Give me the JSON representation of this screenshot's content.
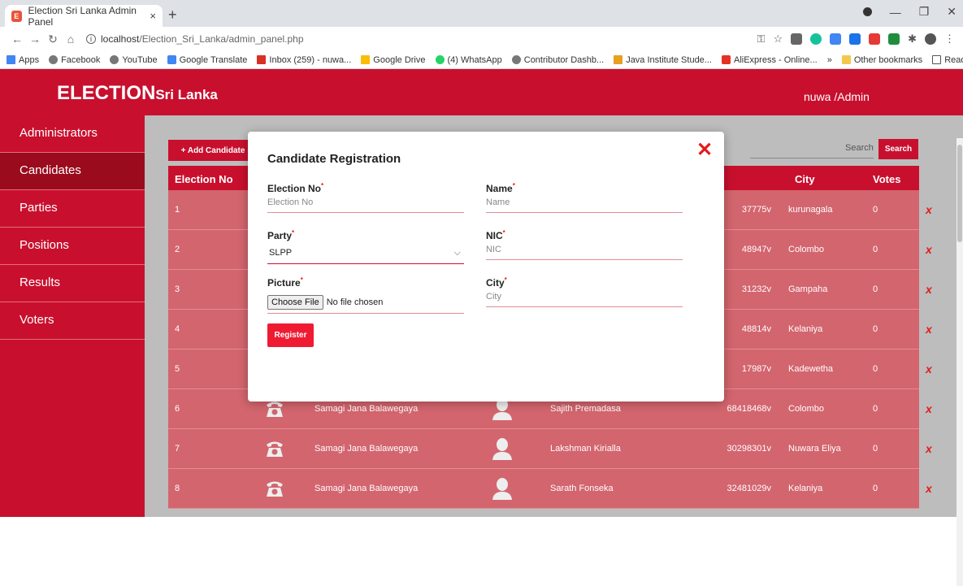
{
  "browser": {
    "tab_title": "Election Sri Lanka Admin Panel",
    "tab_close": "×",
    "new_tab": "+",
    "url_host": "localhost",
    "url_path": "/Election_Sri_Lanka/admin_panel.php",
    "bookmarks": [
      "Apps",
      "Facebook",
      "YouTube",
      "Google Translate",
      "Inbox (259) - nuwa...",
      "Google Drive",
      "(4) WhatsApp",
      "Contributor Dashb...",
      "Java Institute Stude...",
      "AliExpress - Online..."
    ],
    "bookmarks_more": "»",
    "other_bookmarks": "Other bookmarks",
    "reading_list": "Reading list"
  },
  "header": {
    "logo_bold": "ELECTION",
    "logo_rest": "Sri Lanka",
    "user": "nuwa /Admin"
  },
  "sidebar": {
    "items": [
      "Administrators",
      "Candidates",
      "Parties",
      "Positions",
      "Results",
      "Voters"
    ],
    "active": "Candidates"
  },
  "toolbar": {
    "add_label": "+ Add Candidate",
    "search_placeholder": "Search",
    "search_label": "Search"
  },
  "table": {
    "headers": {
      "election_no": "Election No",
      "city": "City",
      "votes": "Votes"
    },
    "rows": [
      {
        "no": "1",
        "party": "",
        "name": "",
        "nic": "37775v",
        "city": "kurunagala",
        "votes": "0"
      },
      {
        "no": "2",
        "party": "",
        "name": "",
        "nic": "48947v",
        "city": "Colombo",
        "votes": "0"
      },
      {
        "no": "3",
        "party": "",
        "name": "",
        "nic": "31232v",
        "city": "Gampaha",
        "votes": "0"
      },
      {
        "no": "4",
        "party": "",
        "name": "",
        "nic": "48814v",
        "city": "Kelaniya",
        "votes": "0"
      },
      {
        "no": "5",
        "party": "",
        "name": "",
        "nic": "17987v",
        "city": "Kadewetha",
        "votes": "0"
      },
      {
        "no": "6",
        "party": "Samagi Jana Balawegaya",
        "name": "Sajith Premadasa",
        "nic": "68418468v",
        "city": "Colombo",
        "votes": "0"
      },
      {
        "no": "7",
        "party": "Samagi Jana Balawegaya",
        "name": "Lakshman Kirialla",
        "nic": "30298301v",
        "city": "Nuwara Eliya",
        "votes": "0"
      },
      {
        "no": "8",
        "party": "Samagi Jana Balawegaya",
        "name": "Sarath Fonseka",
        "nic": "32481029v",
        "city": "Kelaniya",
        "votes": "0"
      }
    ],
    "delete_mark": "x"
  },
  "modal": {
    "title": "Candidate Registration",
    "close": "✕",
    "election_no_label": "Election No",
    "election_no_placeholder": "Election No",
    "name_label": "Name",
    "name_placeholder": "Name",
    "party_label": "Party",
    "party_value": "SLPP",
    "nic_label": "NIC",
    "nic_placeholder": "NIC",
    "picture_label": "Picture",
    "choose_file": "Choose File",
    "no_file": "No file chosen",
    "city_label": "City",
    "city_placeholder": "City",
    "register_label": "Register",
    "required_mark": "*"
  }
}
